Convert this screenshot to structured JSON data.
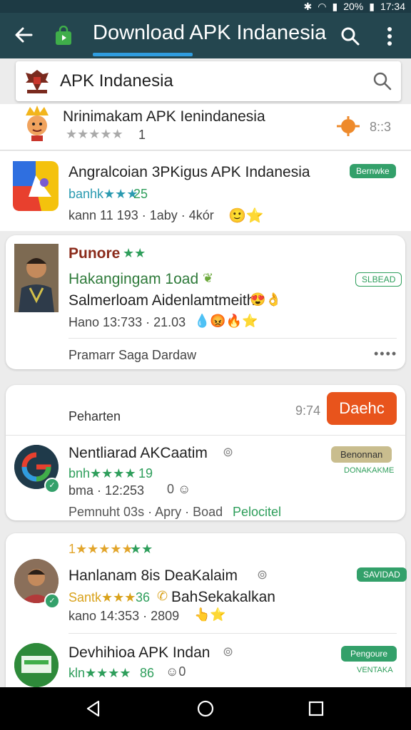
{
  "status": {
    "battery": "20%",
    "time": "17:34"
  },
  "appbar": {
    "title": "Download APK Indanesia"
  },
  "search": {
    "value": "APK Indanesia"
  },
  "featured": {
    "title": "Nrinimakam APK Ienindanesia",
    "rating": "★★★★★",
    "count": "1",
    "right_text": "8::3"
  },
  "apps": [
    {
      "name": "Angralcoian 3PKigus APK Indanesia",
      "stars": "banhk★★★",
      "rating": "25",
      "meta": "kann 11 193 · 1aby · 4kór",
      "badge": "Bernwke"
    },
    {
      "publisher": "Punore",
      "pub_stars": "★★",
      "name": "Hakangingam 1oad",
      "sub": "Salmerloam Aidenlamtmeith",
      "meta": "Hano 13:733 · 21.03",
      "badge": "SLBEAD",
      "footer": "Pramarr Saga Dardaw",
      "more": "••••"
    },
    {
      "header": "Peharten",
      "time": "9:74",
      "button": "Daehc"
    },
    {
      "name": "Nentliarad AKCaatim",
      "stars": "bnh★★★★",
      "rating": "19",
      "meta": "bma · 12:253",
      "badge": "Benonnan",
      "sub_badge": "DONAKAKME",
      "footer_text": "Pemnuht 03s · Apry · Boad",
      "footer_link": "Pelocitel"
    },
    {
      "top_stars": "1★★★★★",
      "top_stars_green": "★★",
      "name": "Hanlanam 8is DeaKalaim",
      "stars": "Santk★★★",
      "rating": "36",
      "sub": "BahSekakalkan",
      "meta": "kano 14:353 · 2809",
      "badge": "SAVIDAD"
    },
    {
      "name": "Devhihioa APK Indan",
      "stars": "kln★★★★",
      "rating": "86",
      "badge": "Pengoure",
      "sub_badge": "VENTAKA"
    }
  ],
  "colors": {
    "appbar": "#24464f",
    "statusbar": "#1d3a44",
    "accent_green": "#2e9e5b",
    "orange_button": "#e8541c",
    "tab_underline": "#2f9de0"
  }
}
